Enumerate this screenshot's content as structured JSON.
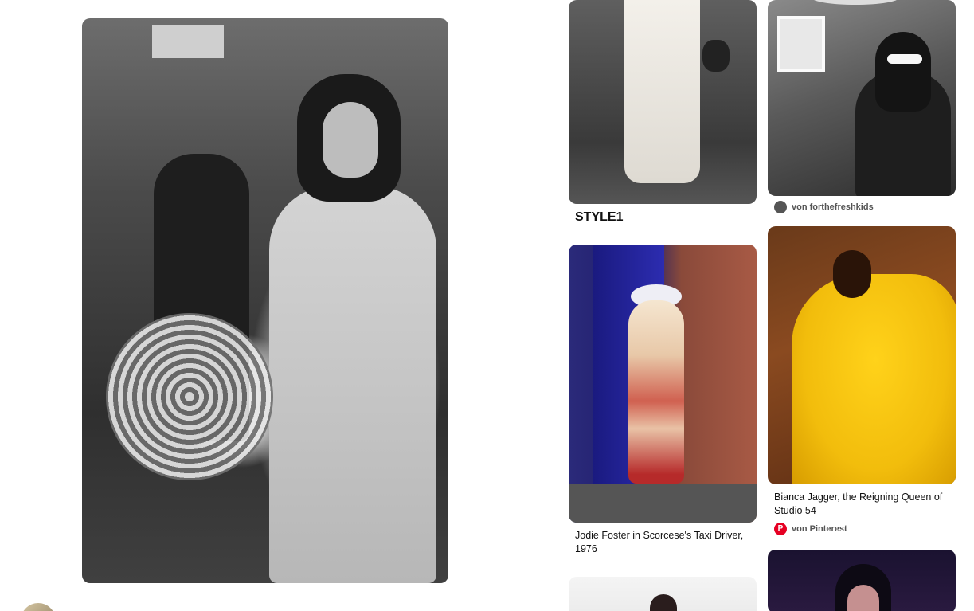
{
  "closeup": {
    "image_alt": "Woman in white lace dress with crochet bag"
  },
  "grid": {
    "pins": [
      {
        "id": "style1",
        "title": "STYLE1"
      },
      {
        "id": "francoise",
        "source": "von forthefreshkids"
      },
      {
        "id": "jodie",
        "title": "Jodie Foster in Scorcese's Taxi Driver, 1976"
      },
      {
        "id": "bianca",
        "title": "Bianca Jagger, the Reigning Queen of Studio 54",
        "source": "von Pinterest"
      },
      {
        "id": "bottom-left"
      },
      {
        "id": "bottom-right"
      }
    ]
  },
  "colors": {
    "pinterest_red": "#e60023",
    "text_primary": "#111111",
    "text_secondary": "#555555"
  }
}
